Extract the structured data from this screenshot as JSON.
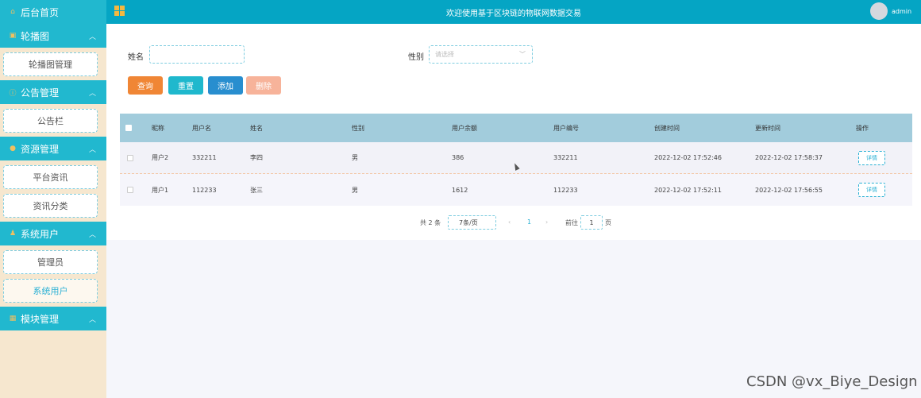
{
  "topbar": {
    "title": "欢迎使用基于区块链的物联网数据交易",
    "username": "admin"
  },
  "sidebar": {
    "home": "后台首页",
    "groups": [
      {
        "label": "轮播图",
        "icon": "image-icon",
        "items": [
          "轮播图管理"
        ]
      },
      {
        "label": "公告管理",
        "icon": "info-icon",
        "items": [
          "公告栏"
        ]
      },
      {
        "label": "资源管理",
        "icon": "location-icon",
        "items": [
          "平台资讯",
          "资讯分类"
        ]
      },
      {
        "label": "系统用户",
        "icon": "user-icon",
        "items": [
          "管理员",
          "系统用户"
        ]
      },
      {
        "label": "模块管理",
        "icon": "module-icon",
        "items": []
      }
    ],
    "active_item": "系统用户"
  },
  "filters": {
    "name_label": "姓名",
    "name_value": "",
    "gender_label": "性别",
    "gender_placeholder": "请选择"
  },
  "buttons": {
    "query": "查询",
    "reset": "重置",
    "add": "添加",
    "delete": "删除"
  },
  "table": {
    "headers": [
      "昵称",
      "用户名",
      "姓名",
      "性别",
      "用户余额",
      "用户编号",
      "创建时间",
      "更新时间",
      "操作"
    ],
    "rows": [
      {
        "nickname": "用户2",
        "username": "332211",
        "name": "李四",
        "gender": "男",
        "balance": "386",
        "user_no": "332211",
        "created": "2022-12-02 17:52:46",
        "updated": "2022-12-02 17:58:37",
        "action": "详情"
      },
      {
        "nickname": "用户1",
        "username": "112233",
        "name": "张三",
        "gender": "男",
        "balance": "1612",
        "user_no": "112233",
        "created": "2022-12-02 17:52:11",
        "updated": "2022-12-02 17:56:55",
        "action": "详情"
      }
    ]
  },
  "pagination": {
    "total": "共 2 条",
    "page_size": "7条/页",
    "prev": "‹",
    "current": "1",
    "next": "›",
    "goto": "前往",
    "goto_value": "1",
    "page_unit": "页"
  },
  "watermark": "CSDN @vx_Biye_Design",
  "colors": {
    "sidebar_bg": "#f6e7cf",
    "menu_head": "#21b8cf",
    "topbar": "#05a5c4",
    "table_header": "#a2ccdc",
    "query": "#f08635",
    "reset": "#1fb8cd",
    "add": "#288ecf",
    "delete": "#f7b39a"
  }
}
